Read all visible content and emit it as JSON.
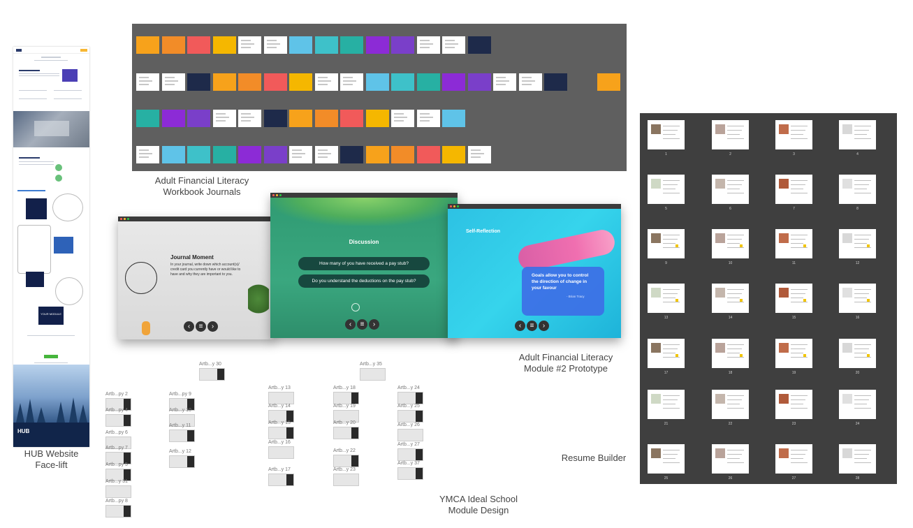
{
  "captions": {
    "hub": "HUB Website\nFace-lift",
    "workbook": "Adult Financial Literacy\nWorkbook Journals",
    "module": "Adult Financial Literacy\nModule #2 Prototype",
    "resume": "Resume Builder",
    "ymca": "YMCA Ideal School\nModule Design"
  },
  "hub_site": {
    "logo": "HUB",
    "module_label": "YOUR MODULE"
  },
  "journal_slide": {
    "heading": "Journal Moment",
    "body": "In your journal, write down which account(s)/ credit card you currently have or would like to have and why they are important to you."
  },
  "discussion_slide": {
    "heading": "Discussion",
    "questions": [
      "How many of you have received a pay stub?",
      "Do you understand the deductions on the pay stub?"
    ]
  },
  "self_reflection_slide": {
    "heading": "Self-Reflection",
    "quote": "Goals allow you to control the direction of change in your favour",
    "author": "- Brian Tracy"
  },
  "nav_icons": [
    "arrow-left-icon",
    "menu-icon",
    "arrow-right-icon"
  ],
  "artboards": [
    {
      "label": "Artb...y 30"
    },
    {
      "label": "Artb...y 35"
    },
    {
      "label": "Artb...py 2"
    },
    {
      "label": "Artb...py 4"
    },
    {
      "label": "Artb...py 6"
    },
    {
      "label": "Artb...py 7"
    },
    {
      "label": "Artb...py 5"
    },
    {
      "label": "Artb...y 31"
    },
    {
      "label": "Artb...py 8"
    },
    {
      "label": "Artb...py 9"
    },
    {
      "label": "Artb...y 10"
    },
    {
      "label": "Artb...y 11"
    },
    {
      "label": "Artb...y 12"
    },
    {
      "label": "Artb...y 13"
    },
    {
      "label": "Artb...y 14"
    },
    {
      "label": "Artb...y 15"
    },
    {
      "label": "Artb...y 16"
    },
    {
      "label": "Artb...y 17"
    },
    {
      "label": "Artb...y 18"
    },
    {
      "label": "Artb...y 19"
    },
    {
      "label": "Artb...y 20"
    },
    {
      "label": "Artb...y 22"
    },
    {
      "label": "Artb...y 23"
    },
    {
      "label": "Artb...y 24"
    },
    {
      "label": "Artb...y 25"
    },
    {
      "label": "Artb...y 26"
    },
    {
      "label": "Artb...y 27"
    },
    {
      "label": "Artb...y 37"
    }
  ],
  "resume_pages": [
    "1",
    "2",
    "3",
    "4",
    "5",
    "6",
    "7",
    "8",
    "9",
    "10",
    "11",
    "12",
    "13",
    "14",
    "15",
    "16",
    "17",
    "18",
    "19",
    "20",
    "21",
    "22",
    "23",
    "24",
    "25",
    "26",
    "27",
    "28"
  ],
  "colors": {
    "board_gray": "#5f5f5f",
    "resume_board": "#3f3f3f",
    "discussion_green": "#3aa77f",
    "self_reflection_cyan": "#36d4ec",
    "hub_navy": "#11254a"
  }
}
